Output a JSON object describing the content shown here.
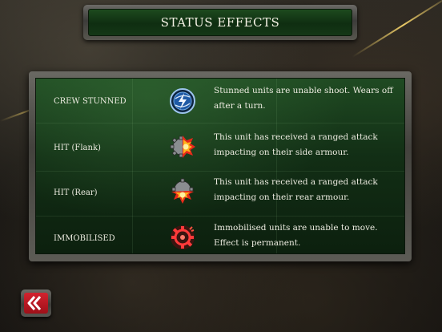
{
  "header": {
    "title": "STATUS EFFECTS"
  },
  "effects": [
    {
      "name": "CREW STUNNED",
      "icon": "stunned-icon",
      "description": "Stunned units are unable shoot.  Wears off after a turn."
    },
    {
      "name": "HIT (Flank)",
      "icon": "hit-flank-icon",
      "description": "This unit has received a ranged attack impacting on their side armour."
    },
    {
      "name": "HIT (Rear)",
      "icon": "hit-rear-icon",
      "description": "This unit has received a ranged attack impacting on their rear armour."
    },
    {
      "name": "IMMOBILISED",
      "icon": "immobilised-icon",
      "description": "Immobilised units are unable to move.  Effect is permanent."
    }
  ],
  "footer": {
    "back_icon": "back-arrow-icon"
  },
  "colors": {
    "panel_green": "#1f4a22",
    "title_green": "#1d4a1e",
    "back_red": "#c81c28",
    "stun_blue": "#3a78c8",
    "hit_orange": "#f0a020",
    "immobilised_red": "#e0202a"
  }
}
